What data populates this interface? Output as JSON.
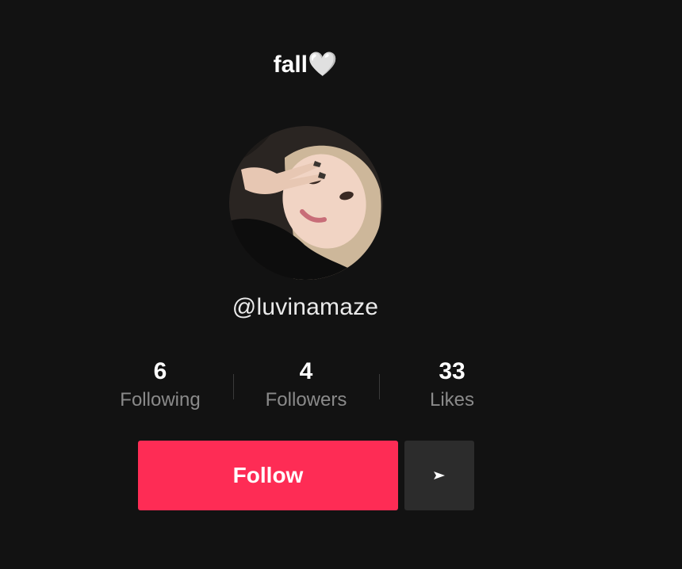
{
  "profile": {
    "title": "fall🤍",
    "username": "@luvinamaze",
    "avatar_alt": "profile photo"
  },
  "stats": [
    {
      "value": "6",
      "label": "Following"
    },
    {
      "value": "4",
      "label": "Followers"
    },
    {
      "value": "33",
      "label": "Likes"
    }
  ],
  "actions": {
    "follow_label": "Follow",
    "more_icon": "triangle-right-icon"
  },
  "colors": {
    "background": "#121212",
    "follow_button": "#fe2c55",
    "secondary_button": "#2c2c2c",
    "muted_text": "#8a8a8a"
  }
}
